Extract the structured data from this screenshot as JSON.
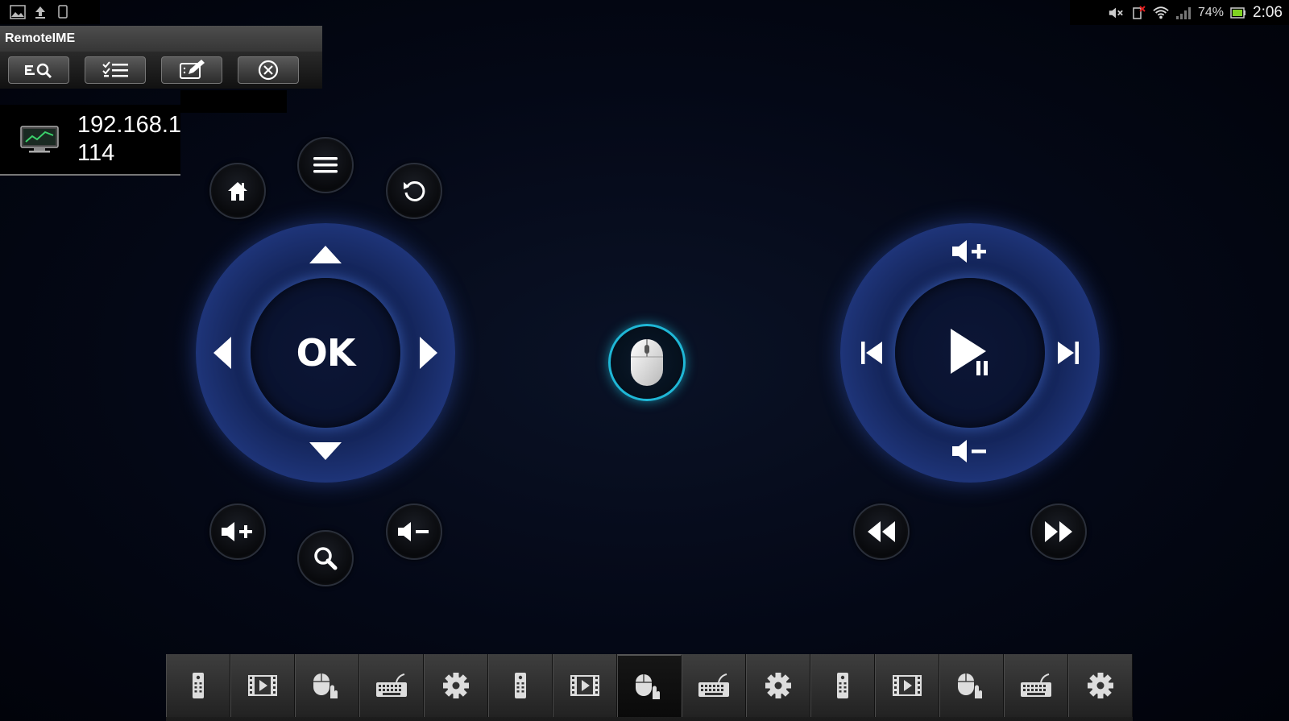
{
  "status_bar": {
    "left_icons": [
      "image-icon",
      "upload-icon",
      "phone-icon"
    ],
    "right_icons": [
      "mute-icon",
      "sim-error-icon",
      "wifi-icon",
      "signal-icon",
      "battery-icon"
    ],
    "battery": "74%",
    "time": "2:06"
  },
  "app": {
    "title": "RemoteIME",
    "toolbar": [
      {
        "name": "search-device-button",
        "icon": "search-list-icon"
      },
      {
        "name": "device-list-button",
        "icon": "checklist-icon"
      },
      {
        "name": "edit-button",
        "icon": "edit-icon"
      },
      {
        "name": "close-button",
        "icon": "close-circle-icon"
      }
    ],
    "device": {
      "icon": "monitor-icon",
      "line1": "192.168.1",
      "line2": "114"
    }
  },
  "remote": {
    "dpad": {
      "center_label": "OK",
      "up": "arrow-up-icon",
      "down": "arrow-down-icon",
      "left": "arrow-left-icon",
      "right": "arrow-right-icon"
    },
    "buttons_left": [
      "home-icon",
      "menu-icon",
      "back-icon",
      "volume-up-icon",
      "search-icon",
      "volume-down-icon"
    ],
    "media_ring": {
      "top": "volume-up-icon",
      "bottom": "volume-down-icon",
      "left": "previous-track-icon",
      "right": "next-track-icon",
      "center": "play-pause-icon"
    },
    "buttons_right": [
      "rewind-icon",
      "fast-forward-icon"
    ],
    "mouse": "mouse-icon"
  },
  "tabbar": {
    "active_index": 7,
    "tabs": [
      "remote-icon",
      "media-icon",
      "mouse-touch-icon",
      "keyboard-icon",
      "settings-icon",
      "remote-icon",
      "media-icon",
      "mouse-touch-icon",
      "keyboard-icon",
      "settings-icon",
      "remote-icon",
      "media-icon",
      "mouse-touch-icon",
      "keyboard-icon",
      "settings-icon"
    ]
  },
  "colors": {
    "accent_cyan": "#1fb7d6",
    "ring_blue": "#2b4696",
    "background": "#02050f"
  }
}
